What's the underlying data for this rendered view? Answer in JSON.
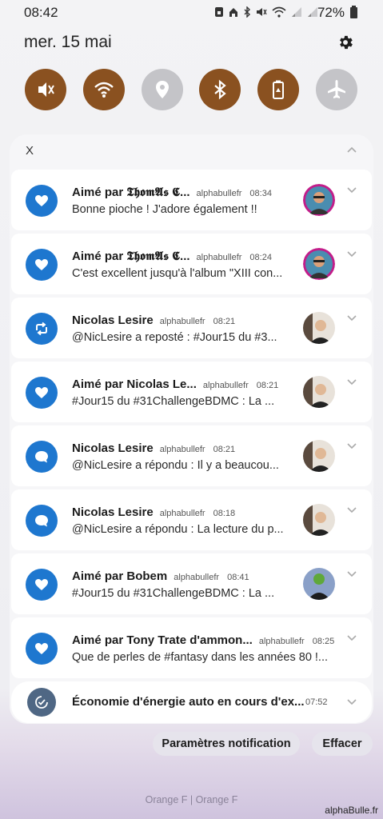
{
  "status_bar": {
    "time": "08:42",
    "battery_text": "72%",
    "icons": [
      "sim-icon",
      "home-icon",
      "bluetooth-icon",
      "mute-icon",
      "wifi-icon",
      "signal-icon",
      "signal-icon"
    ]
  },
  "header": {
    "date": "mer. 15 mai"
  },
  "quick_settings": [
    {
      "name": "mute-toggle",
      "icon": "mute-icon",
      "state": "on"
    },
    {
      "name": "wifi-toggle",
      "icon": "wifi-icon",
      "state": "on"
    },
    {
      "name": "location-toggle",
      "icon": "location-icon",
      "state": "off"
    },
    {
      "name": "bluetooth-toggle",
      "icon": "bluetooth-icon",
      "state": "on"
    },
    {
      "name": "power-saving-toggle",
      "icon": "battery-saver-icon",
      "state": "on"
    },
    {
      "name": "airplane-toggle",
      "icon": "airplane-icon",
      "state": "off"
    }
  ],
  "panel": {
    "app_label": "X"
  },
  "notifications": [
    {
      "icon": "heart-icon",
      "title": "Aimé par 𝕿𝖍𝖔𝖒𝕬𝖘 𝕮...",
      "account": "alphabullefr",
      "time": "08:34",
      "body": "Bonne pioche ! J'adore également !!"
    },
    {
      "icon": "heart-icon",
      "title": "Aimé par 𝕿𝖍𝖔𝖒𝕬𝖘 𝕮...",
      "account": "alphabullefr",
      "time": "08:24",
      "body": "C'est excellent jusqu'à l'album \"XIII con..."
    },
    {
      "icon": "repost-icon",
      "title": "Nicolas Lesire",
      "account": "alphabullefr",
      "time": "08:21",
      "body": "@NicLesire a reposté : #Jour15 du #3..."
    },
    {
      "icon": "heart-icon",
      "title": "Aimé par Nicolas Le...",
      "account": "alphabullefr",
      "time": "08:21",
      "body": "#Jour15 du #31ChallengeBDMC : La ..."
    },
    {
      "icon": "reply-icon",
      "title": "Nicolas Lesire",
      "account": "alphabullefr",
      "time": "08:21",
      "body": "@NicLesire a répondu : Il y a beaucou..."
    },
    {
      "icon": "reply-icon",
      "title": "Nicolas Lesire",
      "account": "alphabullefr",
      "time": "08:18",
      "body": "@NicLesire a répondu : La lecture du p..."
    },
    {
      "icon": "heart-icon",
      "title": "Aimé par Bobem",
      "account": "alphabullefr",
      "time": "08:41",
      "body": "#Jour15 du #31ChallengeBDMC : La ..."
    },
    {
      "icon": "heart-icon",
      "title": "Aimé par Tony Trate d'ammon...",
      "account": "alphabullefr",
      "time": "08:25",
      "body": "Que de perles de #fantasy dans les années 80 !..."
    }
  ],
  "system_notification": {
    "icon": "battery-check-icon",
    "title": "Économie d'énergie auto en cours d'ex...",
    "time": "07:52"
  },
  "actions": {
    "settings_label": "Paramètres notification",
    "clear_label": "Effacer"
  },
  "carrier": "Orange F | Orange F",
  "watermark": "alphaBulle.fr",
  "colors": {
    "toggle_on": "#8a5120",
    "toggle_off": "#c4c4c8",
    "icon_blue": "#1e77cf",
    "icon_grey": "#4f6784"
  }
}
